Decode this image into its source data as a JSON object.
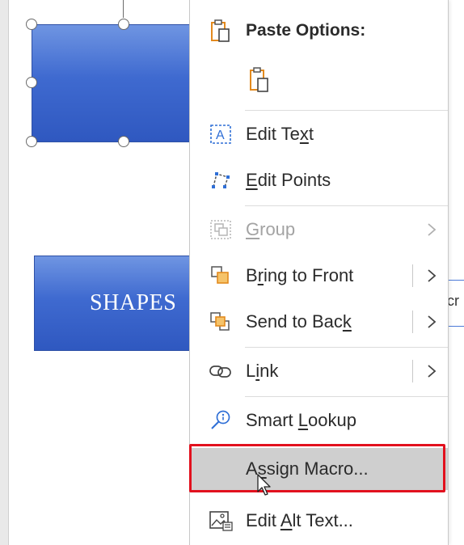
{
  "canvas": {
    "shape_label": "SHAPES",
    "connector_text": "cr",
    "shape_fill": "#3f6ad0"
  },
  "context_menu": {
    "paste_header": "Paste Options:",
    "items": [
      {
        "label": "Edit Text",
        "icon": "edit-text-icon",
        "shortcut_char": "x"
      },
      {
        "label": "Edit Points",
        "icon": "edit-points-icon",
        "shortcut_char": "E"
      },
      {
        "label": "Group",
        "icon": "group-icon",
        "shortcut_char": "G",
        "disabled": true,
        "submenu": true
      },
      {
        "label": "Bring to Front",
        "icon": "bring-to-front-icon",
        "shortcut_char": "r",
        "submenu": true
      },
      {
        "label": "Send to Back",
        "icon": "send-to-back-icon",
        "shortcut_char": "k",
        "submenu": true
      },
      {
        "label": "Link",
        "icon": "link-icon",
        "shortcut_char": "i",
        "submenu": true
      },
      {
        "label": "Smart Lookup",
        "icon": "smart-lookup-icon",
        "shortcut_char": "L"
      },
      {
        "label": "Assign Macro...",
        "icon": "",
        "shortcut_char": "s",
        "highlighted": true
      },
      {
        "label": "Edit Alt Text...",
        "icon": "alt-text-icon",
        "shortcut_char": "A"
      }
    ]
  },
  "colors": {
    "accent": "#2f6fd6",
    "highlight_border": "#e2111e",
    "hover_bg": "#cfcfcf",
    "orange_icon": "#e38a1e"
  }
}
